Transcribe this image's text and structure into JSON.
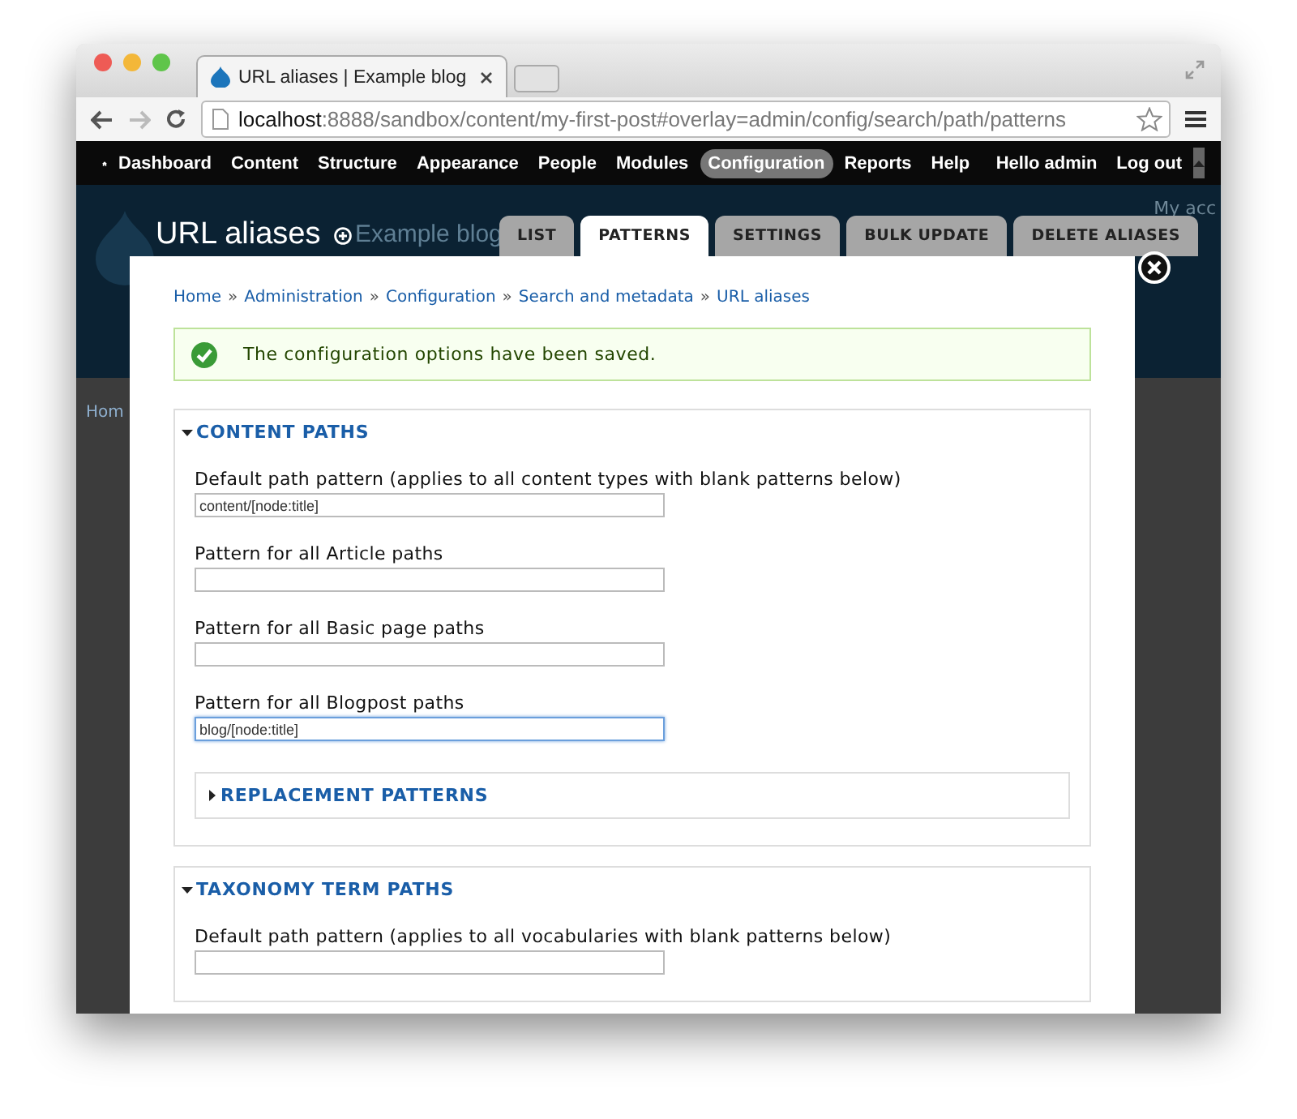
{
  "browser": {
    "tab_title": "URL aliases | Example blog",
    "url_host": "localhost",
    "url_rest": ":8888/sandbox/content/my-first-post#overlay=admin/config/search/path/patterns"
  },
  "toolbar": {
    "items": [
      {
        "label": "Dashboard",
        "selected": false
      },
      {
        "label": "Content",
        "selected": false
      },
      {
        "label": "Structure",
        "selected": false
      },
      {
        "label": "Appearance",
        "selected": false
      },
      {
        "label": "People",
        "selected": false
      },
      {
        "label": "Modules",
        "selected": false
      },
      {
        "label": "Configuration",
        "selected": true
      },
      {
        "label": "Reports",
        "selected": false
      },
      {
        "label": "Help",
        "selected": false
      }
    ],
    "user": "Hello admin",
    "logout": "Log out"
  },
  "background": {
    "site_name": "Example blog",
    "account_link": "My acc",
    "breadcrumb": "Hom"
  },
  "overlay": {
    "title": "URL aliases",
    "tabs": [
      {
        "label": "LIST",
        "selected": false
      },
      {
        "label": "PATTERNS",
        "selected": true
      },
      {
        "label": "SETTINGS",
        "selected": false
      },
      {
        "label": "BULK UPDATE",
        "selected": false
      },
      {
        "label": "DELETE ALIASES",
        "selected": false
      }
    ],
    "breadcrumb": [
      "Home",
      "Administration",
      "Configuration",
      "Search and metadata",
      "URL aliases"
    ],
    "separator": "»",
    "message": "The configuration options have been saved.",
    "fieldsets": [
      {
        "legend": "CONTENT PATHS",
        "expanded": true,
        "fields": [
          {
            "label": "Default path pattern (applies to all content types with blank patterns below)",
            "value": "content/[node:title]",
            "focused": false
          },
          {
            "label": "Pattern for all Article paths",
            "focused": false
          },
          {
            "label": "Pattern for all Basic page paths",
            "focused": false
          },
          {
            "label": "Pattern for all Blogpost paths",
            "value": "blog/[node:title]",
            "focused": true
          }
        ],
        "subsections": [
          {
            "legend": "REPLACEMENT PATTERNS",
            "expanded": false
          }
        ]
      },
      {
        "legend": "TAXONOMY TERM PATHS",
        "expanded": true,
        "fields": [
          {
            "label": "Default path pattern (applies to all vocabularies with blank patterns below)",
            "focused": false
          }
        ]
      }
    ]
  }
}
